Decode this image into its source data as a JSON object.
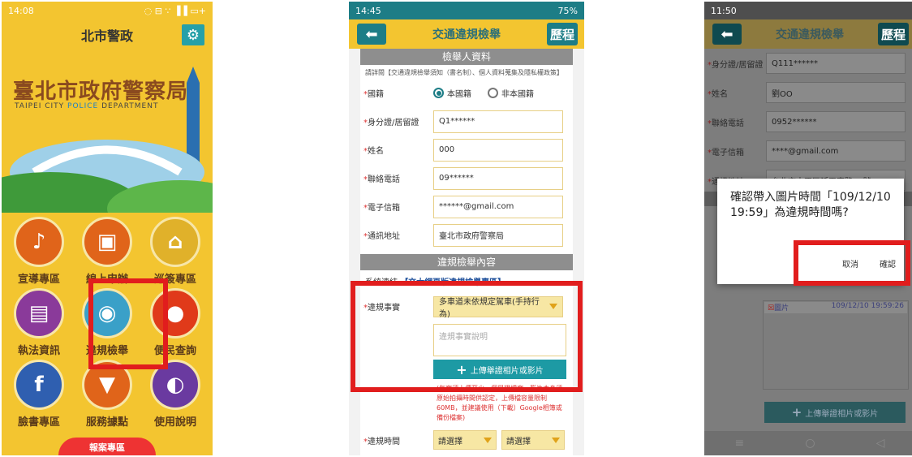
{
  "phone1": {
    "status": {
      "time": "14:08",
      "right": "◌ ⊟ ∵ ▐▐ ▭+"
    },
    "title": "北市警政",
    "brand": "臺北市政府警察局",
    "subtitle_pre": "TAIPEI CITY ",
    "subtitle_hl": "POLICE",
    "subtitle_post": " DEPARTMENT",
    "tiles": [
      {
        "label": "宣導專區",
        "color": "#e0641a",
        "glyph": "♪"
      },
      {
        "label": "線上申辦",
        "color": "#e0641a",
        "glyph": "▣"
      },
      {
        "label": "巡簽專區",
        "color": "#e0b12a",
        "glyph": "⌂"
      },
      {
        "label": "執法資訊",
        "color": "#8a3a9a",
        "glyph": "▤"
      },
      {
        "label": "違規檢舉",
        "color": "#3aa0c8",
        "glyph": "◉"
      },
      {
        "label": "便民查詢",
        "color": "#e03a1a",
        "glyph": "●"
      },
      {
        "label": "臉書專區",
        "color": "#2f5fb0",
        "glyph": "f"
      },
      {
        "label": "服務據點",
        "color": "#e0641a",
        "glyph": "▼"
      },
      {
        "label": "使用說明",
        "color": "#6a3aa0",
        "glyph": "◐"
      }
    ],
    "bottom_text": "報案專區"
  },
  "phone2": {
    "status": {
      "time": "14:45",
      "battery": "75%"
    },
    "title": "交通違規檢舉",
    "history": "歷程",
    "section1": "檢舉人資料",
    "note_pre": "請詳閱【交通違規檢舉須知（書名制）、個人資料蒐集及隱私權政策】",
    "fields": {
      "nationality_label": "國籍",
      "nat_opt1": "本國籍",
      "nat_opt2": "非本國籍",
      "id_label": "身分證/居留證",
      "id_value": "Q1******",
      "name_label": "姓名",
      "name_value": "000",
      "phone_label": "聯絡電話",
      "phone_value": "09******",
      "email_label": "電子信箱",
      "email_value": "******@gmail.com",
      "address_label": "通訊地址",
      "address_value": "臺北市政府警察局"
    },
    "section2": "違規檢舉內容",
    "syslink_label": "系統連結",
    "syslink_value": "【交大網頁版違規檢舉專區】",
    "violation_label": "違規事實",
    "violation_value": "多車道未依規定駕車(手持行為)",
    "violation_placeholder": "違規事實說明",
    "upload_label": "上傳舉證相片或影片",
    "upload_note": "(每案須上傳至少一個舉證檔案，影片本身須原始拍攝時間供認定，上傳檔容量限制60MB，並建議使用（下載）Google相簿或備份檔案)",
    "time_label": "違規時間",
    "time_sel1": "請選擇",
    "time_sel2": "請選擇"
  },
  "phone3": {
    "status": {
      "time": "11:50"
    },
    "title": "交通違規檢舉",
    "history": "歷程",
    "rows": [
      {
        "label": "身分證/居留證",
        "value": "Q111******"
      },
      {
        "label": "姓名",
        "value": "劉OO"
      },
      {
        "label": "聯絡電話",
        "value": "0952******"
      },
      {
        "label": "電子信箱",
        "value": "****@gmail.com"
      },
      {
        "label": "通訊地址",
        "value": "台北市中正區延平南路96號"
      }
    ],
    "dialog_msg": "確認帶入圖片時間「109/12/10 19:59」為違規時間嗎?",
    "cancel": "取消",
    "confirm": "確認",
    "img_label": "圖片",
    "img_time": "109/12/10 19:59:26",
    "upload_label": "上傳舉證相片或影片"
  },
  "colors": {
    "highlight": "#e11d1d",
    "teal": "#1d7d86",
    "yellow": "#f3c530"
  }
}
